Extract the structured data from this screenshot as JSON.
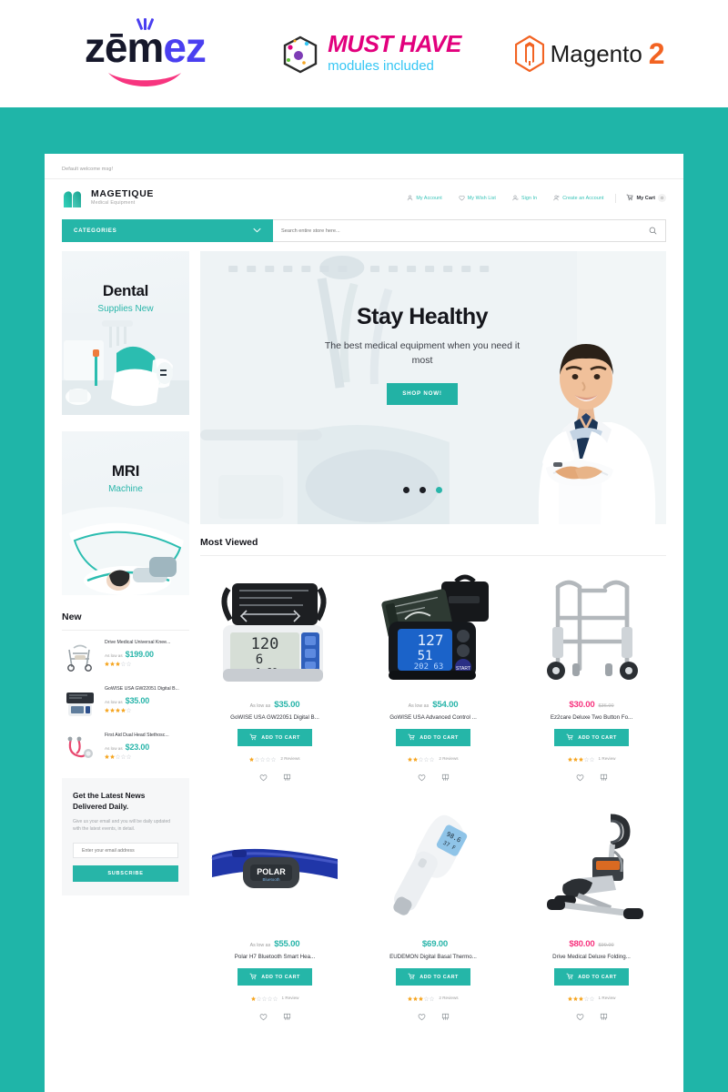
{
  "promo": {
    "zemez": {
      "part1": "z",
      "part2": "ēm",
      "part3": "e",
      "part4": "z",
      "alt": "zemez"
    },
    "musthave": {
      "title": "MUST HAVE",
      "subtitle": "modules included"
    },
    "magento": {
      "word": "Magento",
      "version": "2"
    }
  },
  "store": {
    "welcome_message": "Default welcome msg!",
    "brand": {
      "name": "MAGETIQUE",
      "tagline": "Medical Equipment"
    },
    "header_links": [
      {
        "label": "My Account",
        "icon": "user-icon"
      },
      {
        "label": "My Wish List",
        "icon": "heart-icon"
      },
      {
        "label": "Sign In",
        "icon": "user-check-icon"
      },
      {
        "label": "Create an Account",
        "icon": "user-add-icon"
      }
    ],
    "cart": {
      "label": "My Cart",
      "count": "0",
      "icon": "cart-icon"
    },
    "search": {
      "categories_label": "CATEGORIES",
      "placeholder": "Search entire store here...",
      "value": ""
    }
  },
  "sidebar": {
    "tiles": [
      {
        "title": "Dental",
        "subtitle": "Supplies New"
      },
      {
        "title": "MRI",
        "subtitle": "Machine"
      }
    ],
    "new_block_title": "New",
    "new_products": [
      {
        "name": "Drive Medical Universal Knee...",
        "as_low_as": "As low as",
        "price": "$199.00",
        "rating": 3,
        "thumb": "rollator-walker"
      },
      {
        "name": "GoWISE USA GW22051 Digital B...",
        "as_low_as": "As low as",
        "price": "$35.00",
        "rating": 4,
        "thumb": "blood-pressure-monitor"
      },
      {
        "name": "First Aid Dual Head Stethosc...",
        "as_low_as": "As low as",
        "price": "$23.00",
        "rating": 2,
        "thumb": "stethoscope"
      }
    ],
    "newsletter": {
      "title": "Get the Latest News Delivered Daily.",
      "description": "Give us your email and you will be daily updated with the latest events, in detail.",
      "placeholder": "Enter your email address",
      "value": "",
      "button": "SUBSCRIBE"
    }
  },
  "hero": {
    "title": "Stay Healthy",
    "subtitle": "The best medical equipment when you need it most",
    "button": "SHOP NOW!",
    "slides": 3,
    "active_slide": 3
  },
  "most_viewed": {
    "title": "Most Viewed",
    "products": [
      {
        "as_low_as": "As low as",
        "price": "$35.00",
        "old_price": "",
        "special": false,
        "name": "GoWISE USA GW22051 Digital B...",
        "add_to_cart": "ADD TO CART",
        "rating": 1,
        "reviews": "2 Reviews",
        "image": "bp-monitor-white"
      },
      {
        "as_low_as": "As low as",
        "price": "$54.00",
        "old_price": "",
        "special": false,
        "name": "GoWISE USA Advanced Control ...",
        "add_to_cart": "ADD TO CART",
        "rating": 2,
        "reviews": "2 Reviews",
        "image": "bp-monitor-black"
      },
      {
        "as_low_as": "",
        "price": "$30.00",
        "old_price": "$36.00",
        "special": true,
        "name": "Ez2care Deluxe Two Button Fo...",
        "add_to_cart": "ADD TO CART",
        "rating": 3,
        "reviews": "1 Review",
        "image": "walker"
      },
      {
        "as_low_as": "As low as",
        "price": "$55.00",
        "old_price": "",
        "special": false,
        "name": "Polar H7 Bluetooth Smart Hea...",
        "add_to_cart": "ADD TO CART",
        "rating": 1,
        "reviews": "1 Review",
        "image": "heart-rate-strap"
      },
      {
        "as_low_as": "",
        "price": "$69.00",
        "old_price": "",
        "special": false,
        "name": "EUDEMON Digital Basal Thermo...",
        "add_to_cart": "ADD TO CART",
        "rating": 3,
        "reviews": "2 Reviews",
        "image": "thermometer"
      },
      {
        "as_low_as": "",
        "price": "$80.00",
        "old_price": "$99.00",
        "special": true,
        "name": "Drive Medical Deluxe Folding...",
        "add_to_cart": "ADD TO CART",
        "rating": 3,
        "reviews": "1 Review",
        "image": "pedal-exerciser"
      }
    ]
  },
  "colors": {
    "teal": "#1fb5a8",
    "teal_dark": "#25b6a8",
    "accent_pink": "#f7357f",
    "star": "#f5a623",
    "text_dark": "#15161c"
  }
}
